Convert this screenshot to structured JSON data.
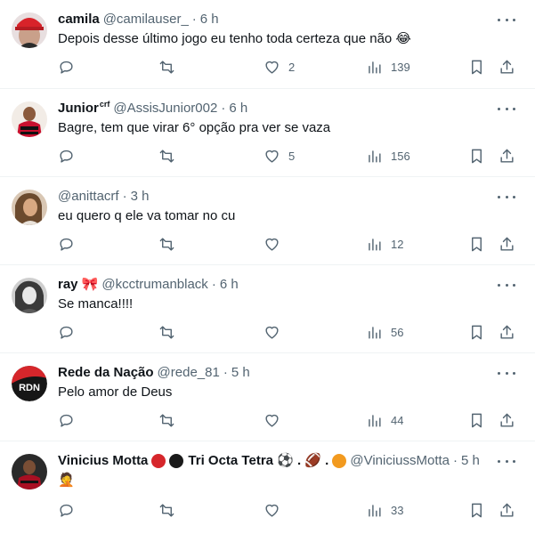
{
  "posts": [
    {
      "name": "camila",
      "name_sup": "",
      "handle": "@camilauser_",
      "time": "6 h",
      "text": "Depois desse último jogo eu tenho toda certeza que não 😂",
      "replies": "",
      "retweets": "",
      "likes": "2",
      "views": "139"
    },
    {
      "name": "Junior",
      "name_sup": "crf",
      "handle": "@AssisJunior002",
      "time": "6 h",
      "text": "Bagre, tem que virar 6° opção pra ver se vaza",
      "replies": "",
      "retweets": "",
      "likes": "5",
      "views": "156"
    },
    {
      "name": "",
      "name_sup": "",
      "handle": "@anittacrf",
      "time": "3 h",
      "text": "eu quero q ele va tomar no cu",
      "replies": "",
      "retweets": "",
      "likes": "",
      "views": "12"
    },
    {
      "name": "ray 🎀",
      "name_sup": "",
      "handle": "@kcctrumanblack",
      "time": "6 h",
      "text": "Se manca!!!!",
      "replies": "",
      "retweets": "",
      "likes": "",
      "views": "56"
    },
    {
      "name": "Rede da Nação",
      "name_sup": "",
      "handle": "@rede_81",
      "time": "5 h",
      "text": "Pelo amor de Deus",
      "replies": "",
      "retweets": "",
      "likes": "",
      "views": "44"
    },
    {
      "name": "Vinicius Motta",
      "name_extra": "Tri Octa Tetra ⚽ . 🏈 .",
      "name_sup": "",
      "handle": "@ViniciussMotta",
      "time": "5 h",
      "text": "🤦",
      "replies": "",
      "retweets": "",
      "likes": "",
      "views": "33"
    }
  ],
  "colors": {
    "text": "#0f1419",
    "secondary": "#536471",
    "divider": "#eff3f4",
    "flamengo_red": "#d6262b",
    "flamengo_black": "#1a1a1a"
  },
  "icons": [
    "reply-icon",
    "retweet-icon",
    "like-icon",
    "views-icon",
    "bookmark-icon",
    "share-icon",
    "more-icon"
  ]
}
